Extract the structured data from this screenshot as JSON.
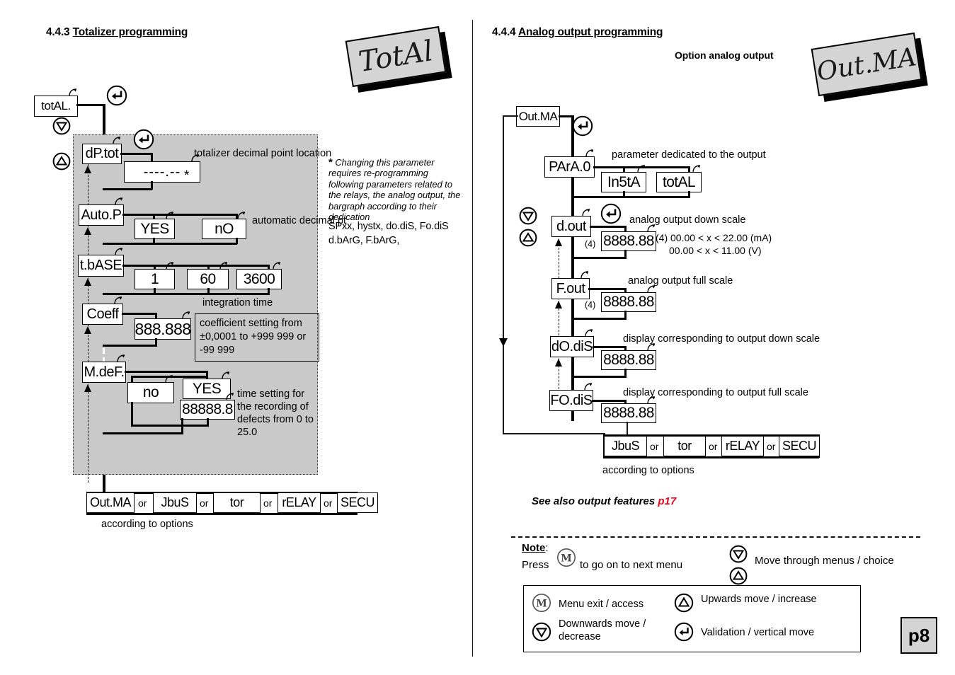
{
  "page": {
    "number": "p8",
    "divider_color": "#1a1a1a"
  },
  "left_section": {
    "heading_number": "4.4.3",
    "heading_title": "Totalizer programming",
    "badge": "TotAl",
    "entry_box": "totAL.",
    "steps": [
      {
        "name": "dP.tot",
        "values": [
          "----.--"
        ],
        "caption": "totalizer decimal point\nlocation",
        "star": "*"
      },
      {
        "name": "Auto.P",
        "values": [
          "YES",
          "nO"
        ],
        "caption": "automatic\ndecimal pt"
      },
      {
        "name": "t.bASE",
        "values": [
          "1",
          "60",
          "3600"
        ],
        "caption": "integration time"
      },
      {
        "name": "Coeff",
        "values": [
          "888.888"
        ],
        "caption": "coefficient setting from\n±0,0001 to +999 999\n            or -99 999"
      },
      {
        "name": "M.deF.",
        "values": [
          "no",
          "YES",
          "88888.8"
        ],
        "caption": "time setting for\nthe recording of\ndefects from 0 to\n25.0"
      }
    ],
    "star_note": {
      "marker": "*",
      "italic_text": "Changing this parameter requires re-programming following parameters related to the relays, the analog output, the bargraph according to their dedication",
      "plain_line1": "SPxx, hystx, do.diS, Fo.diS",
      "plain_line2": "d.bArG, F.bArG,"
    },
    "options_row": {
      "items": [
        "Out.MA",
        "JbuS",
        "tor",
        "rELAY",
        "SECU"
      ],
      "separator": "or",
      "caption": "according to options"
    }
  },
  "right_section": {
    "heading_number": "4.4.4",
    "heading_title": "Analog output programming",
    "option_label": "Option analog output",
    "badge": "Out.MA",
    "entry_box": "Out.MA",
    "steps": [
      {
        "name": "PArA.0",
        "values": [
          "In5tA",
          "totAL"
        ],
        "caption": "parameter dedicated to the output"
      },
      {
        "name": "d.out",
        "values": [
          "8888.88"
        ],
        "caption": "analog output down scale",
        "note_marker": "(4)",
        "note_line1": "(4) 00.00 < x < 22.00 (mA)",
        "note_line2": "00.00 < x < 11.00 (V)"
      },
      {
        "name": "F.out",
        "values": [
          "8888.88"
        ],
        "caption": "analog output full scale",
        "note_marker": "(4)"
      },
      {
        "name": "dO.diS",
        "values": [
          "8888.88"
        ],
        "caption": "display corresponding to output down scale"
      },
      {
        "name": "FO.diS",
        "values": [
          "8888.88"
        ],
        "caption": "display corresponding to output full scale"
      }
    ],
    "options_row": {
      "items": [
        "JbuS",
        "tor",
        "rELAY",
        "SECU"
      ],
      "separator": "or",
      "caption": "according to options"
    },
    "see_also": {
      "text": "See also output features",
      "page_ref": "p17",
      "page_ref_color": "#e8001c"
    }
  },
  "note": {
    "label": "Note",
    "colon": ":",
    "press_word": "Press",
    "press_icon": "menu-key-icon",
    "press_rest": "to go on to next menu",
    "move_icon_down": "down-triangle-key-icon",
    "move_icon_up": "up-triangle-key-icon",
    "move_text": "Move through menus / choice"
  },
  "legend": {
    "items": [
      {
        "icon": "menu-key-icon",
        "label": "Menu exit / access"
      },
      {
        "icon": "up-triangle-key-icon",
        "label": "Upwards move / increase"
      },
      {
        "icon": "down-triangle-key-icon",
        "label": "Downwards move /\ndecrease"
      },
      {
        "icon": "enter-key-icon",
        "label": "Validation / vertical move"
      }
    ]
  }
}
